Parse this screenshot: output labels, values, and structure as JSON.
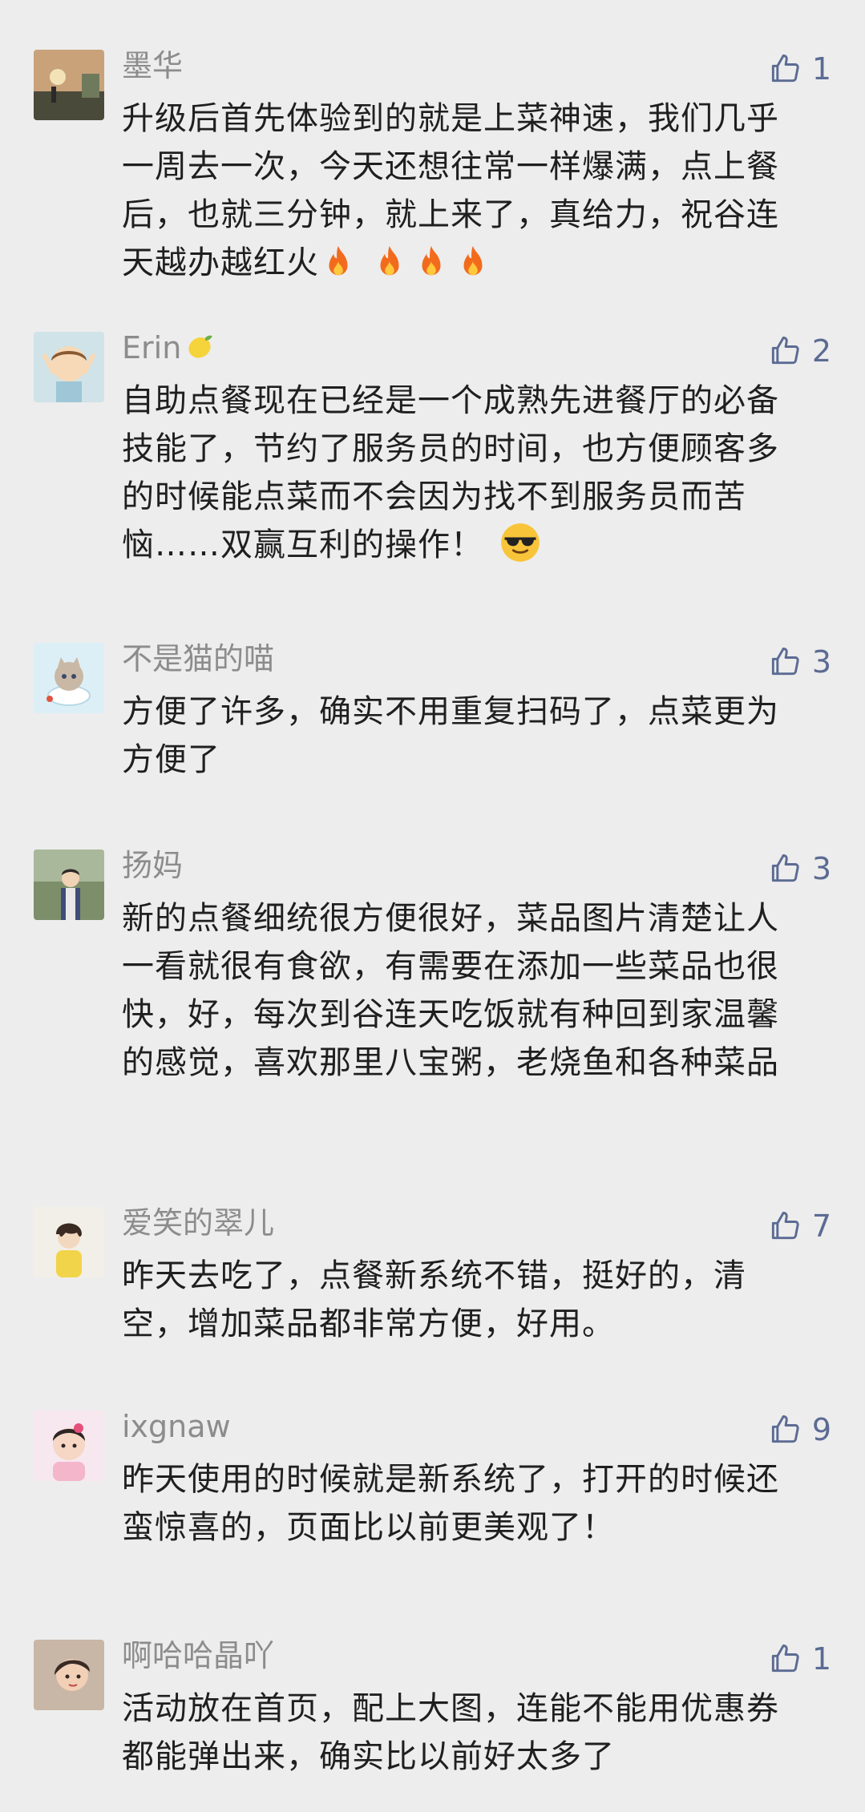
{
  "comments": [
    {
      "name": "墨华",
      "likes": "1",
      "text": "升级后首先体验到的就是上菜神速，我们几乎一周去一次，今天还想往常一样爆满，点上餐后，也就三分钟，就上来了，真给力，祝谷连天越办越红火",
      "emojis": [
        "fire",
        "fire",
        "fire",
        "fire"
      ]
    },
    {
      "name": "Erin",
      "likes": "2",
      "text": "自助点餐现在已经是一个成熟先进餐厅的必备技能了，节约了服务员的时间，也方便顾客多的时候能点菜而不会因为找不到服务员而苦恼……双赢互利的操作！",
      "emojis": [
        "sunglasses"
      ]
    },
    {
      "name": "不是猫的喵",
      "likes": "3",
      "text": "方便了许多，确实不用重复扫码了，点菜更为方便了"
    },
    {
      "name": "扬妈",
      "likes": "3",
      "text": "新的点餐细统很方便很好，菜品图片清楚让人一看就很有食欲，有需要在添加一些菜品也很快，好，每次到谷连天吃饭就有种回到家温馨的感觉，喜欢那里八宝粥，老烧鱼和各种菜品"
    },
    {
      "name": "爱笑的翠儿",
      "likes": "7",
      "text": "昨天去吃了，点餐新系统不错，挺好的，清空，增加菜品都非常方便，好用。"
    },
    {
      "name": "ixgnaw",
      "likes": "9",
      "text": "昨天使用的时候就是新系统了，打开的时候还蛮惊喜的，页面比以前更美观了！"
    },
    {
      "name": "啊哈哈晶吖",
      "likes": "1",
      "text": "活动放在首页，配上大图，连能不能用优惠券都能弹出来，确实比以前好太多了"
    }
  ]
}
